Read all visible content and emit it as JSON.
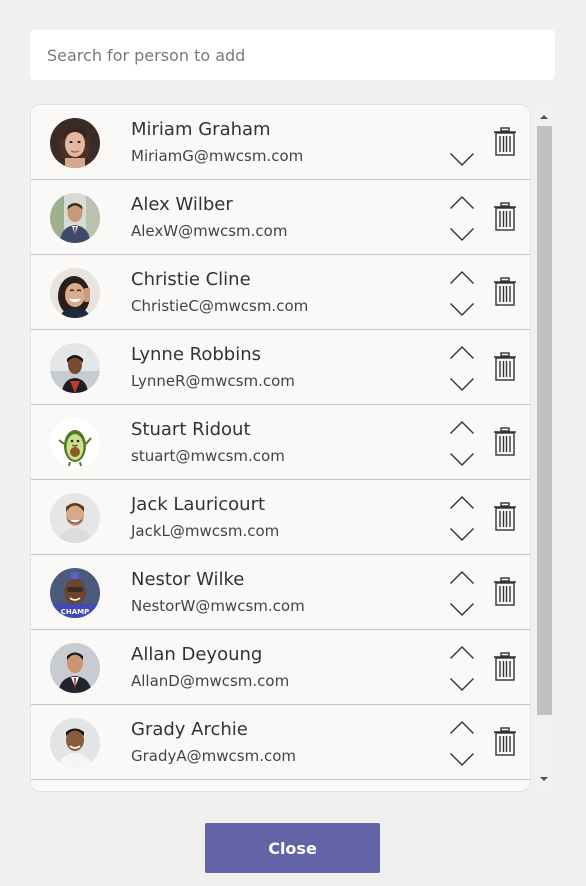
{
  "search": {
    "placeholder": "Search for person to add"
  },
  "people": [
    {
      "name": "Miriam Graham",
      "email": "MiriamG@mwcsm.com",
      "avatar": "woman-brown-hair-photo",
      "show_up": false,
      "show_down": true
    },
    {
      "name": "Alex Wilber",
      "email": "AlexW@mwcsm.com",
      "avatar": "man-in-suit-outdoors-photo",
      "show_up": true,
      "show_down": true
    },
    {
      "name": "Christie Cline",
      "email": "ChristieC@mwcsm.com",
      "avatar": "woman-laughing-phone-photo",
      "show_up": true,
      "show_down": true
    },
    {
      "name": "Lynne Robbins",
      "email": "LynneR@mwcsm.com",
      "avatar": "woman-red-top-photo",
      "show_up": true,
      "show_down": true
    },
    {
      "name": "Stuart Ridout",
      "email": "stuart@mwcsm.com",
      "avatar": "avocado-cartoon",
      "show_up": true,
      "show_down": true
    },
    {
      "name": "Jack Lauricourt",
      "email": "JackL@mwcsm.com",
      "avatar": "man-smiling-photo",
      "show_up": true,
      "show_down": true
    },
    {
      "name": "Nestor Wilke",
      "email": "NestorW@mwcsm.com",
      "avatar": "man-champ-badge-photo",
      "show_up": true,
      "show_down": true
    },
    {
      "name": "Allan Deyoung",
      "email": "AllanD@mwcsm.com",
      "avatar": "man-suit-red-tie-photo",
      "show_up": true,
      "show_down": true
    },
    {
      "name": "Grady Archie",
      "email": "GradyA@mwcsm.com",
      "avatar": "man-white-shirt-photo",
      "show_up": true,
      "show_down": true
    }
  ],
  "icons": {
    "move_up": "chevron-up-icon",
    "move_down": "chevron-down-icon",
    "remove": "trash-icon"
  },
  "avatar_badge": "CHAMP",
  "close_button": {
    "label": "Close"
  },
  "colors": {
    "primary": "#6264a7",
    "background": "#f1f0ef",
    "card": "#faf9f8",
    "divider": "#c8c6c4",
    "scroll_thumb": "#c1c1c1"
  }
}
